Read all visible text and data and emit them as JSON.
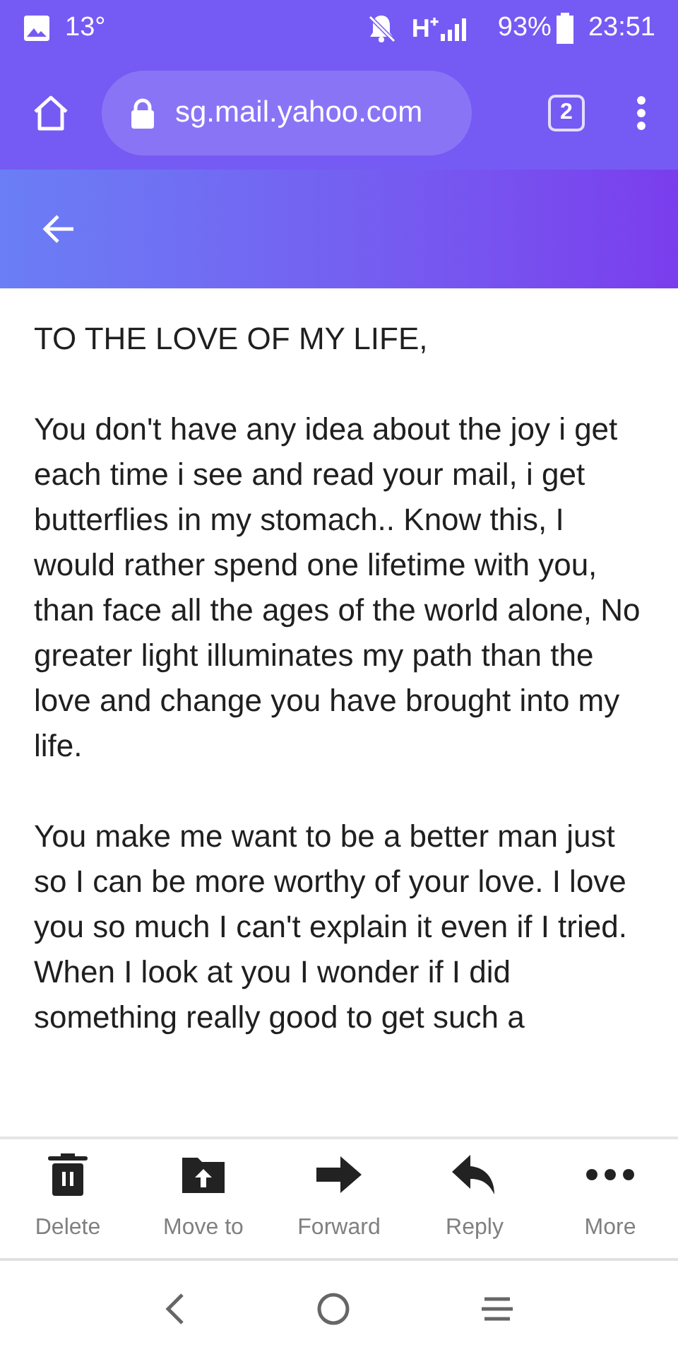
{
  "status_bar": {
    "temperature": "13°",
    "network": "H⁺",
    "battery": "93%",
    "time": "23:51"
  },
  "browser": {
    "url": "sg.mail.yahoo.com",
    "tab_count": "2"
  },
  "message": {
    "paragraphs": [
      "TO THE LOVE OF MY LIFE,",
      "You don't have any idea about the joy i get each time i see and read your mail, i get butterflies in my stomach.. Know this, I would rather spend one lifetime with you, than face all the ages of the world alone, No greater light illuminates my path than the love and change you have brought into my life.",
      "You make me want to be a better man just so I can be more worthy of your love. I love you so much I can't explain it even if I tried.\nWhen I look at you I wonder if I did something really good to get such a"
    ]
  },
  "toolbar": [
    {
      "kind": "delete",
      "label": "Delete"
    },
    {
      "kind": "move",
      "label": "Move to"
    },
    {
      "kind": "forward",
      "label": "Forward"
    },
    {
      "kind": "reply",
      "label": "Reply"
    },
    {
      "kind": "more",
      "label": "More"
    }
  ]
}
